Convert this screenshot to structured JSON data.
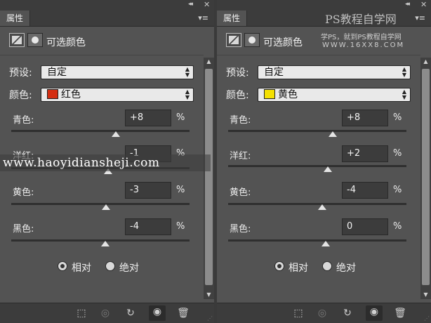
{
  "panel_tab_label": "属性",
  "window_controls": {
    "collapse": "◂◂",
    "close": "✕",
    "menu": "▾≡"
  },
  "adjustment_title": "可选颜色",
  "preset_label": "预设:",
  "color_label": "颜色:",
  "relative_label": "相对",
  "absolute_label": "绝对",
  "percent_sign": "%",
  "panels": [
    {
      "preset_value": "自定",
      "color_value": "红色",
      "swatch_color": "#d42e12",
      "method": "relative",
      "sliders": [
        {
          "label": "青色:",
          "value": "+8",
          "percent": 8
        },
        {
          "label": "洋红:",
          "value": "-1",
          "percent": -1
        },
        {
          "label": "黄色:",
          "value": "-3",
          "percent": -3
        },
        {
          "label": "黑色:",
          "value": "-4",
          "percent": -4
        }
      ]
    },
    {
      "preset_value": "自定",
      "color_value": "黄色",
      "swatch_color": "#f4e000",
      "method": "relative",
      "sliders": [
        {
          "label": "青色:",
          "value": "+8",
          "percent": 8
        },
        {
          "label": "洋红:",
          "value": "+2",
          "percent": 2
        },
        {
          "label": "黄色:",
          "value": "-4",
          "percent": -4
        },
        {
          "label": "黑色:",
          "value": "0",
          "percent": 0
        }
      ]
    }
  ],
  "bottom_icons": [
    "clip-to-layer-icon",
    "view-previous-icon",
    "reset-icon",
    "visibility-eye-icon",
    "trash-icon"
  ],
  "watermarks": {
    "ps_site": "PS教程自学网",
    "ps_tagline": "学PS，就到PS教程自学网",
    "ps_url": "WWW.16XX8.COM",
    "url": "www.haoyidiansheji.com"
  }
}
